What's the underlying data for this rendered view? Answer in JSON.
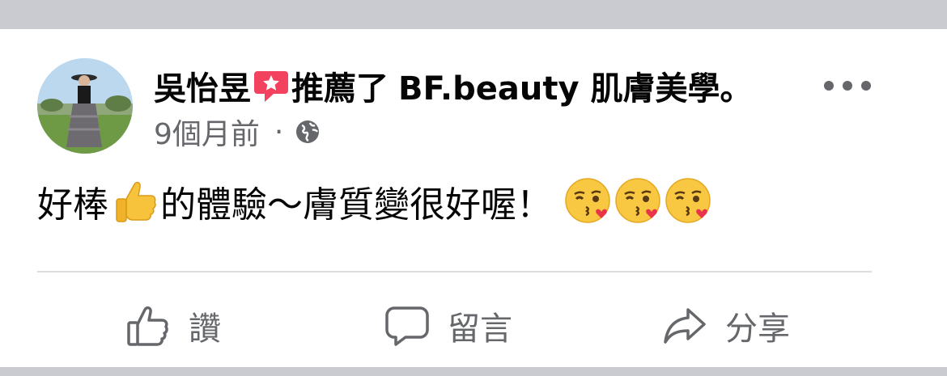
{
  "post": {
    "author": "吳怡昱",
    "recommend_text": "推薦了",
    "page_name": "BF.beauty 肌膚美學",
    "end_punct": "。",
    "timestamp": "9個月前",
    "separator": "·",
    "text_part1": "好棒",
    "text_part2": "的體驗～膚質變很好喔！"
  },
  "actions": {
    "like_label": "讚",
    "comment_label": "留言",
    "share_label": "分享"
  },
  "icons": {
    "recommend": "recommend-badge-icon",
    "privacy": "globe-icon",
    "more": "more-options-icon",
    "like": "thumbs-up-icon",
    "comment": "comment-bubble-icon",
    "share": "share-arrow-icon",
    "emoji_inline": "thumbs-up-emoji",
    "emoji_kiss": "face-blowing-kiss-emoji"
  },
  "colors": {
    "text_primary": "#050505",
    "text_secondary": "#65676b",
    "recommend_red": "#f3425f",
    "background_gray": "#c9cbd0"
  }
}
